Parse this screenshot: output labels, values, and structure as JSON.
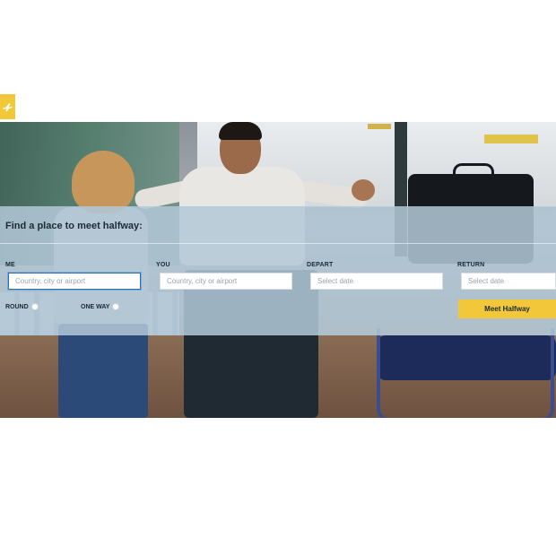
{
  "logo": {
    "icon": "airplane-icon",
    "color": "#f2c73a"
  },
  "search": {
    "title": "Find a place to meet halfway:",
    "fields": {
      "me": {
        "label": "ME",
        "placeholder": "Country, city or airport"
      },
      "you": {
        "label": "YOU",
        "placeholder": "Country, city or airport"
      },
      "depart": {
        "label": "DEPART",
        "placeholder": "Select date"
      },
      "return": {
        "label": "RETURN",
        "placeholder": "Select date"
      }
    },
    "trip_type": {
      "round": "ROUND",
      "one_way": "ONE WAY"
    },
    "submit_label": "Meet Halfway"
  },
  "colors": {
    "accent": "#f2c73a",
    "panel_overlay": "#b2c8d7",
    "text_dark": "#1d2a35",
    "input_focus": "#2f6fb3"
  }
}
